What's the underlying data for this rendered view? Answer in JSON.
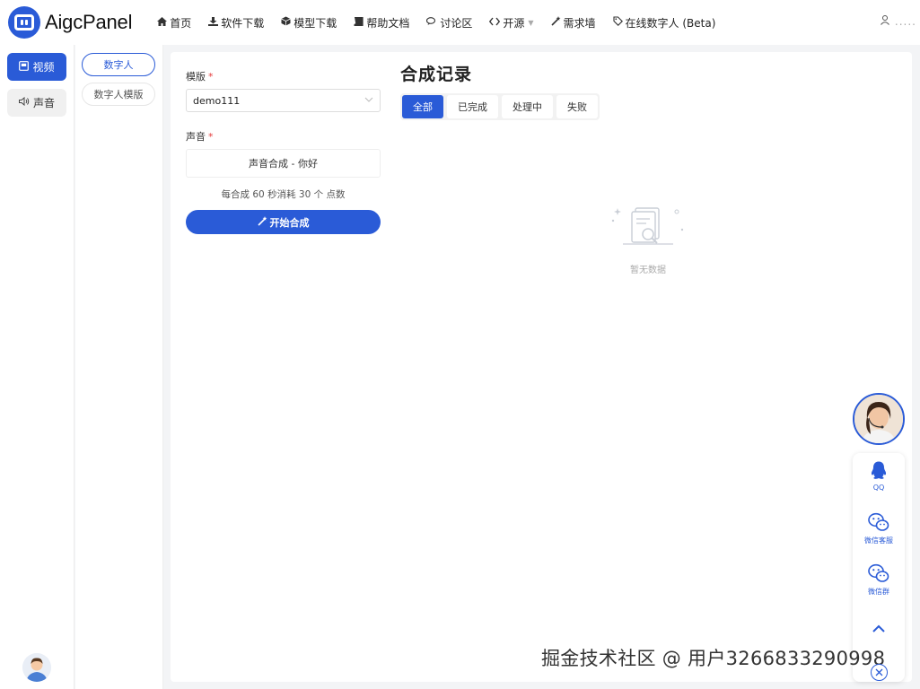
{
  "app": {
    "brand": "AigcPanel"
  },
  "nav": [
    {
      "icon": "home-icon",
      "label": "首页"
    },
    {
      "icon": "download-icon",
      "label": "软件下载"
    },
    {
      "icon": "cube-icon",
      "label": "模型下载"
    },
    {
      "icon": "book-icon",
      "label": "帮助文档"
    },
    {
      "icon": "chat-icon",
      "label": "讨论区"
    },
    {
      "icon": "code-icon",
      "label": "开源"
    },
    {
      "icon": "wand-icon",
      "label": "需求墙"
    },
    {
      "icon": "tag-icon",
      "label": "在线数字人 (Beta)"
    }
  ],
  "user": {
    "name": "....."
  },
  "sidebar": {
    "items": [
      {
        "label": "视频"
      },
      {
        "label": "声音"
      }
    ]
  },
  "subside": {
    "items": [
      {
        "label": "数字人"
      },
      {
        "label": "数字人模版"
      }
    ]
  },
  "form": {
    "template_label": "模版",
    "required_mark": "*",
    "template_value": "demo111",
    "voice_label": "声音",
    "voice_value": "声音合成 - 你好",
    "cost_text": "每合成 60 秒消耗 30 个 点数",
    "start_label": "开始合成"
  },
  "records": {
    "title": "合成记录",
    "tabs": [
      "全部",
      "已完成",
      "处理中",
      "失败"
    ],
    "empty_text": "暂无数据"
  },
  "support": {
    "qq_label": "QQ",
    "wechat_service_label": "微信客服",
    "wechat_group_label": "微信群"
  },
  "watermark": "掘金技术社区 @ 用户3266833290998",
  "colors": {
    "primary": "#2a5bd7",
    "required": "#e53e3e"
  }
}
